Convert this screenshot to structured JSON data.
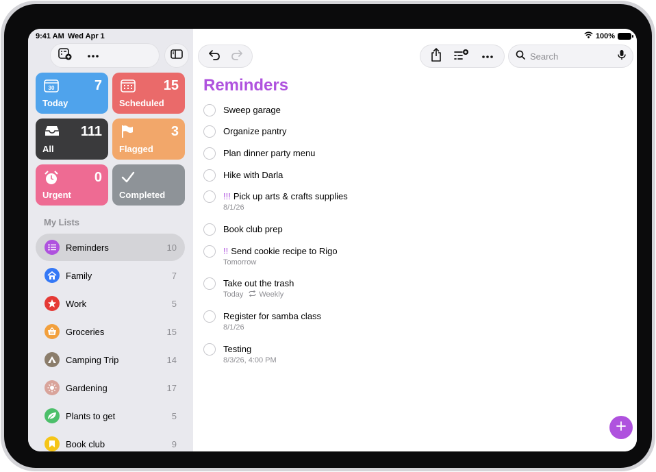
{
  "status": {
    "time": "9:41 AM",
    "date": "Wed Apr 1",
    "battery": "100%"
  },
  "sidebar": {
    "tiles": [
      {
        "label": "Today",
        "count": "7",
        "color": "#4fa3ec",
        "icon": "calendar-today-icon",
        "day": "30"
      },
      {
        "label": "Scheduled",
        "count": "15",
        "color": "#ea6a6a",
        "icon": "calendar-grid-icon"
      },
      {
        "label": "All",
        "count": "111",
        "color": "#3a3a3c",
        "icon": "tray-icon"
      },
      {
        "label": "Flagged",
        "count": "3",
        "color": "#f2a76a",
        "icon": "flag-icon"
      },
      {
        "label": "Urgent",
        "count": "0",
        "color": "#ee6b93",
        "icon": "alarm-icon"
      },
      {
        "label": "Completed",
        "count": "",
        "color": "#8e9398",
        "icon": "checkmark-icon"
      }
    ],
    "section_title": "My Lists",
    "lists": [
      {
        "label": "Reminders",
        "count": "10",
        "color": "#af52de",
        "icon": "list-bullet-icon",
        "active": true
      },
      {
        "label": "Family",
        "count": "7",
        "color": "#3478f6",
        "icon": "house-icon"
      },
      {
        "label": "Work",
        "count": "5",
        "color": "#e53935",
        "icon": "star-icon"
      },
      {
        "label": "Groceries",
        "count": "15",
        "color": "#f2a03d",
        "icon": "basket-icon"
      },
      {
        "label": "Camping Trip",
        "count": "14",
        "color": "#8b7d6b",
        "icon": "tent-icon"
      },
      {
        "label": "Gardening",
        "count": "17",
        "color": "#d9a49b",
        "icon": "sun-icon"
      },
      {
        "label": "Plants to get",
        "count": "5",
        "color": "#4cbf6a",
        "icon": "leaf-icon"
      },
      {
        "label": "Book club",
        "count": "9",
        "color": "#f5c518",
        "icon": "bookmark-icon"
      }
    ]
  },
  "toolbar": {
    "search_placeholder": "Search"
  },
  "main": {
    "title": "Reminders",
    "accent": "#af52de",
    "items": [
      {
        "title": "Sweep garage",
        "priority": "",
        "date": "",
        "repeat": ""
      },
      {
        "title": "Organize pantry",
        "priority": "",
        "date": "",
        "repeat": ""
      },
      {
        "title": "Plan dinner party menu",
        "priority": "",
        "date": "",
        "repeat": ""
      },
      {
        "title": "Hike with Darla",
        "priority": "",
        "date": "",
        "repeat": ""
      },
      {
        "title": "Pick up arts & crafts supplies",
        "priority": "!!!",
        "date": "8/1/26",
        "repeat": ""
      },
      {
        "title": "Book club prep",
        "priority": "",
        "date": "",
        "repeat": ""
      },
      {
        "title": "Send cookie recipe to Rigo",
        "priority": "!!",
        "date": "Tomorrow",
        "repeat": ""
      },
      {
        "title": "Take out the trash",
        "priority": "",
        "date": "Today",
        "repeat": "Weekly"
      },
      {
        "title": "Register for samba class",
        "priority": "",
        "date": "8/1/26",
        "repeat": ""
      },
      {
        "title": "Testing",
        "priority": "",
        "date": "8/3/26, 4:00 PM",
        "repeat": ""
      }
    ]
  }
}
